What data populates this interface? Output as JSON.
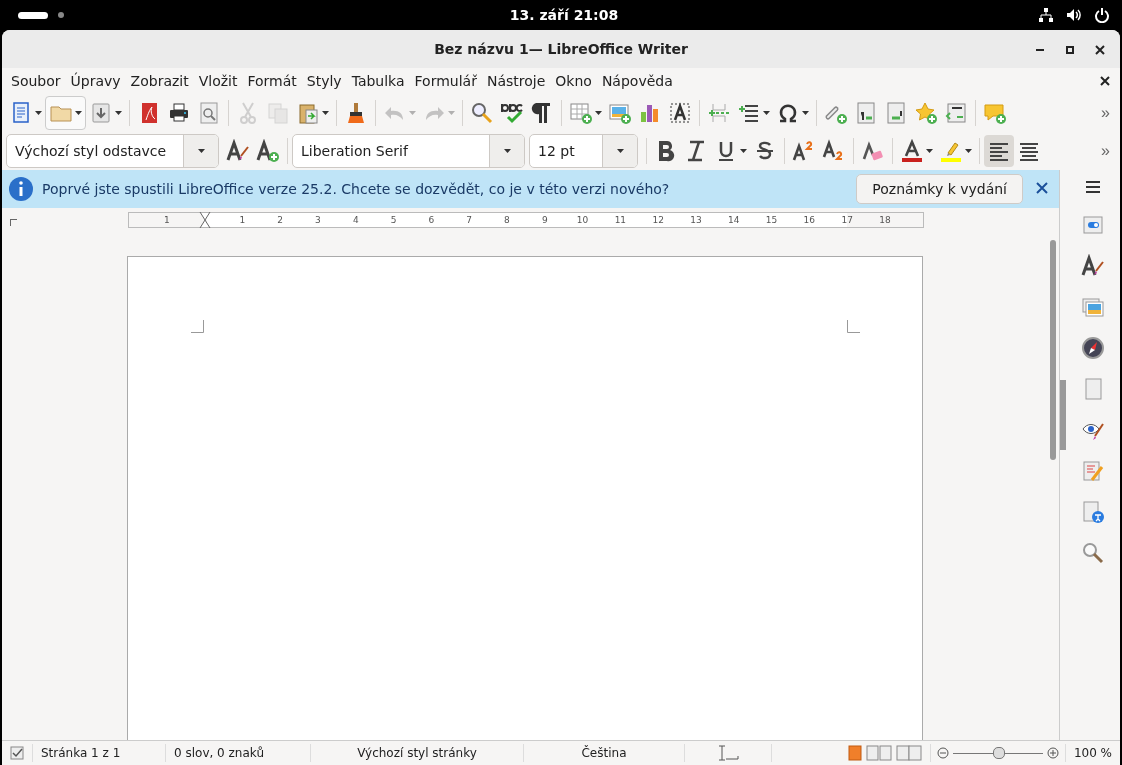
{
  "top_bar": {
    "clock": "13. září  21:08"
  },
  "window": {
    "title": "Bez názvu 1— LibreOffice Writer"
  },
  "menu": [
    "Soubor",
    "Úpravy",
    "Zobrazit",
    "Vložit",
    "Formát",
    "Styly",
    "Tabulka",
    "Formulář",
    "Nástroje",
    "Okno",
    "Nápověda"
  ],
  "standard_toolbar": [
    {
      "kind": "new",
      "dropdown": true,
      "disabled": false
    },
    {
      "kind": "open",
      "dropdown": true,
      "disabled": false
    },
    {
      "kind": "save",
      "dropdown": true,
      "disabled": false
    },
    {
      "kind": "sep"
    },
    {
      "kind": "pdf",
      "dropdown": false,
      "disabled": false
    },
    {
      "kind": "print",
      "dropdown": false,
      "disabled": false
    },
    {
      "kind": "preview",
      "dropdown": false,
      "disabled": false
    },
    {
      "kind": "sep"
    },
    {
      "kind": "cut",
      "dropdown": false,
      "disabled": true
    },
    {
      "kind": "copy",
      "dropdown": false,
      "disabled": true
    },
    {
      "kind": "paste",
      "dropdown": true,
      "disabled": false
    },
    {
      "kind": "sep"
    },
    {
      "kind": "brush",
      "dropdown": false,
      "disabled": false
    },
    {
      "kind": "sep"
    },
    {
      "kind": "undo",
      "dropdown": true,
      "disabled": true
    },
    {
      "kind": "redo",
      "dropdown": true,
      "disabled": true
    },
    {
      "kind": "sep"
    },
    {
      "kind": "find",
      "dropdown": false,
      "disabled": false
    },
    {
      "kind": "spell",
      "dropdown": false,
      "disabled": false
    },
    {
      "kind": "pilcrow",
      "dropdown": false,
      "disabled": false
    },
    {
      "kind": "sep"
    },
    {
      "kind": "table",
      "dropdown": true,
      "disabled": false
    },
    {
      "kind": "image",
      "dropdown": false,
      "disabled": false
    },
    {
      "kind": "chart",
      "dropdown": false,
      "disabled": false
    },
    {
      "kind": "textbox",
      "dropdown": false,
      "disabled": false
    },
    {
      "kind": "sep"
    },
    {
      "kind": "pagebreak",
      "dropdown": false,
      "disabled": false
    },
    {
      "kind": "field",
      "dropdown": true,
      "disabled": false
    },
    {
      "kind": "omega",
      "dropdown": true,
      "disabled": false
    },
    {
      "kind": "sep"
    },
    {
      "kind": "link",
      "dropdown": false,
      "disabled": false
    },
    {
      "kind": "footnote",
      "dropdown": false,
      "disabled": false
    },
    {
      "kind": "endnote",
      "dropdown": false,
      "disabled": false
    },
    {
      "kind": "star",
      "dropdown": false,
      "disabled": false
    },
    {
      "kind": "crossref",
      "dropdown": false,
      "disabled": false
    },
    {
      "kind": "sep"
    },
    {
      "kind": "comment",
      "dropdown": false,
      "disabled": false
    }
  ],
  "standard_toolbar_more": "»",
  "formatting_toolbar": {
    "paragraph_style": "Výchozí styl odstavce",
    "font_name": "Liberation Serif",
    "font_size": "12 pt",
    "buttons": [
      {
        "kind": "bold",
        "dropdown": false
      },
      {
        "kind": "italic",
        "dropdown": false
      },
      {
        "kind": "underline",
        "dropdown": true
      },
      {
        "kind": "strike",
        "dropdown": false
      },
      {
        "kind": "sep"
      },
      {
        "kind": "sup",
        "dropdown": false
      },
      {
        "kind": "sub",
        "dropdown": false
      },
      {
        "kind": "sep"
      },
      {
        "kind": "eraser",
        "dropdown": false
      },
      {
        "kind": "sep"
      },
      {
        "kind": "fontcolor",
        "dropdown": true
      },
      {
        "kind": "highlight",
        "dropdown": true
      },
      {
        "kind": "sep"
      },
      {
        "kind": "alignleft",
        "dropdown": false,
        "selected": true
      },
      {
        "kind": "aligncenter",
        "dropdown": false,
        "selected": false
      }
    ],
    "more": "»"
  },
  "infobar": {
    "message": "Poprvé jste spustili LibreOffice verze 25.2. Chcete se dozvědět, co je v této verzi nového?",
    "button": "Poznámky k vydání"
  },
  "ruler": {
    "labels": [
      "1",
      "1",
      "2",
      "3",
      "4",
      "5",
      "6",
      "7",
      "8",
      "9",
      "10",
      "11",
      "12",
      "13",
      "14",
      "15",
      "16",
      "17",
      "18"
    ]
  },
  "status_bar": {
    "page": "Stránka 1 z 1",
    "words": "0 slov, 0 znaků",
    "page_style": "Výchozí styl stránky",
    "language": "Čeština",
    "zoom": {
      "level": 0.5,
      "reading": "100 %"
    }
  }
}
